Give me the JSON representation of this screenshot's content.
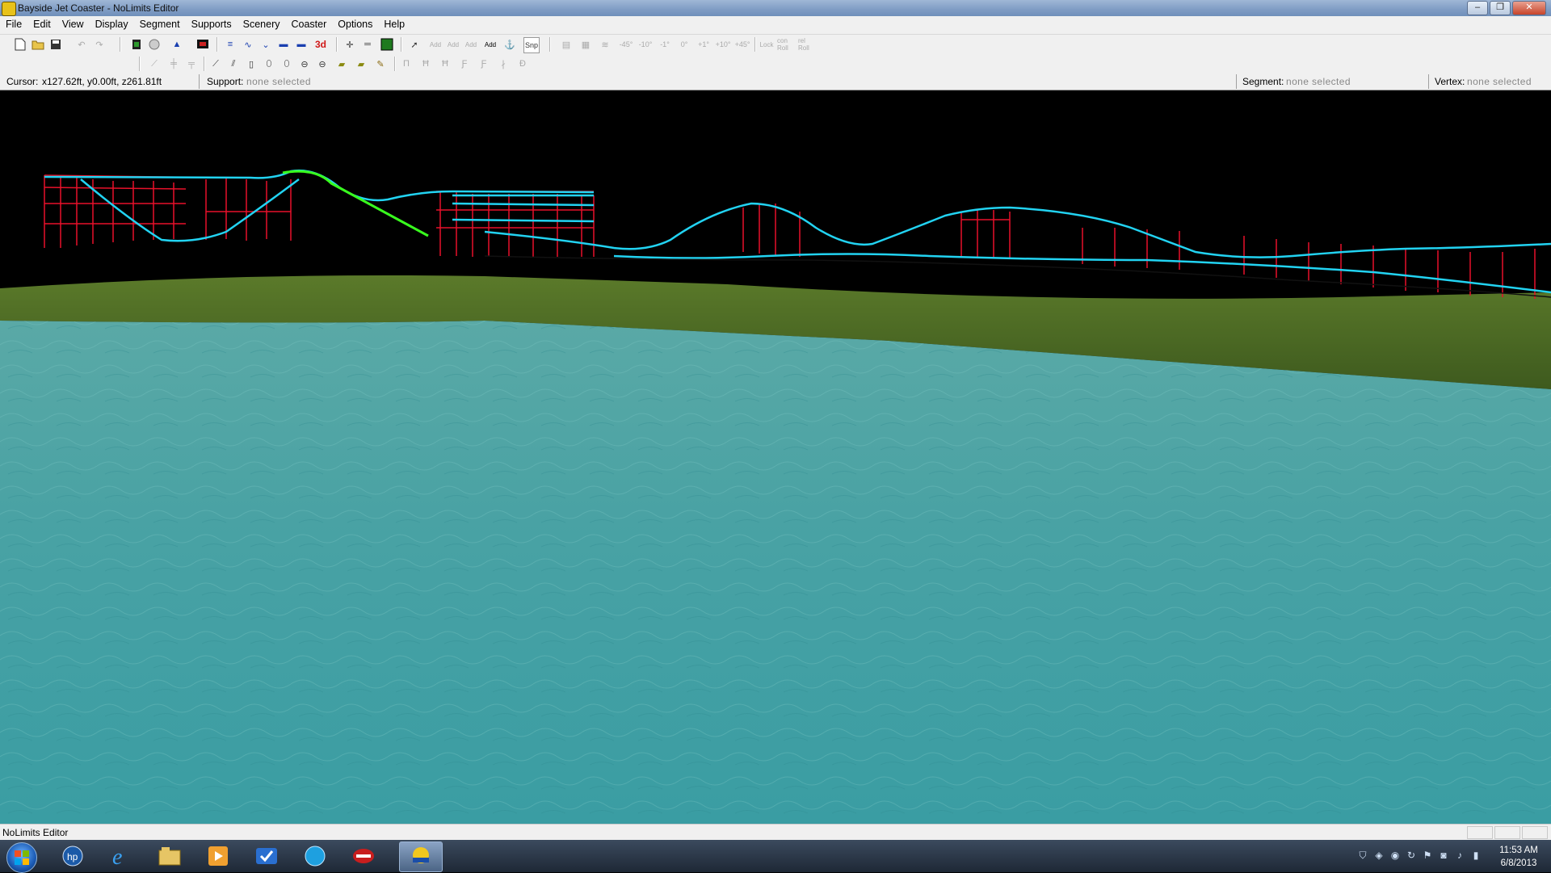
{
  "window": {
    "title": "Bayside Jet Coaster - NoLimits Editor",
    "minimize_label": "–",
    "maximize_label": "❐",
    "close_label": "✕"
  },
  "menu": [
    "File",
    "Edit",
    "View",
    "Display",
    "Segment",
    "Supports",
    "Scenery",
    "Coaster",
    "Options",
    "Help"
  ],
  "toolbar": {
    "label_3d": "3d",
    "snap_label": "Snp",
    "bank_buttons": [
      "-45°",
      "-10°",
      "-1°",
      "0°",
      "+1°",
      "+10°",
      "+45°"
    ],
    "add_labels": [
      "Add",
      "Add",
      "Add",
      "Add"
    ],
    "roll_labels": [
      "Lock",
      "con Roll",
      "rel Roll"
    ]
  },
  "statusbar": {
    "cursor_label": "Cursor:",
    "cursor_value": "x127.62ft, y0.00ft, z261.81ft",
    "support_label": "Support:",
    "support_value": "none selected",
    "segment_label": "Segment:",
    "segment_value": "none selected",
    "vertex_label": "Vertex:",
    "vertex_value": "none selected"
  },
  "app_status": "NoLimits Editor",
  "taskbar": {
    "apps": [
      "hp-icon",
      "internet-explorer-icon",
      "explorer-icon",
      "media-player-icon",
      "tasks-icon",
      "globe-icon",
      "coaster-red-icon",
      "nolimits-icon"
    ],
    "time": "11:53 AM",
    "date": "6/8/2013"
  },
  "colors": {
    "support": "#e8112a",
    "track": "#22d3f2",
    "lift": "#39ff1e",
    "water": "#3fa3a4",
    "ground": "#4f6d24"
  }
}
